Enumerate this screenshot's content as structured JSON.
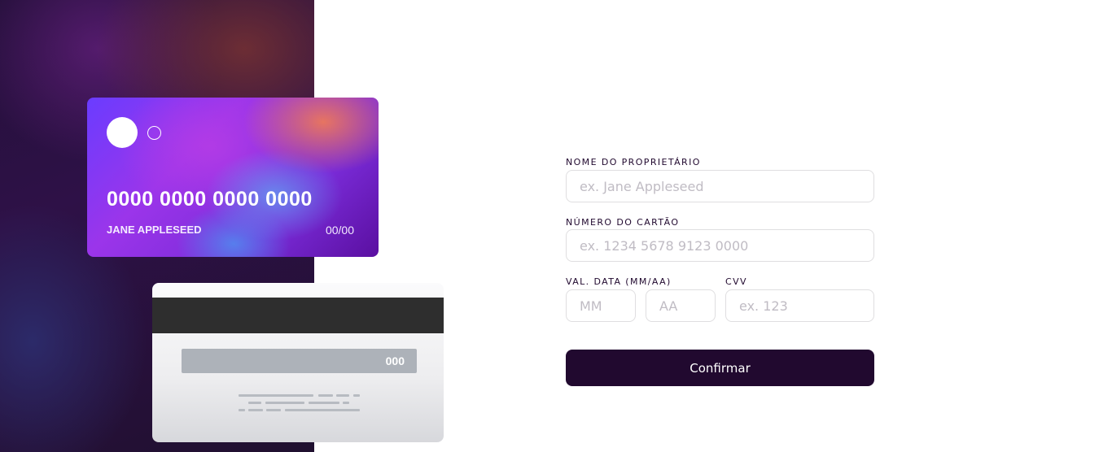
{
  "card_front": {
    "number": "0000 0000 0000 0000",
    "holder": "JANE APPLESEED",
    "expiry": "00/00"
  },
  "card_back": {
    "cvv": "000"
  },
  "form": {
    "name": {
      "label": "NOME DO PROPRIETÁRIO",
      "placeholder": "ex. Jane Appleseed",
      "value": ""
    },
    "number": {
      "label": "NÚMERO DO CARTÃO",
      "placeholder": "ex. 1234 5678 9123 0000",
      "value": ""
    },
    "expiry": {
      "label": "VAL. DATA (MM/AA)",
      "month_placeholder": "MM",
      "year_placeholder": "AA"
    },
    "cvv": {
      "label": "CVV",
      "placeholder": "ex. 123"
    },
    "confirm_label": "Confirmar"
  },
  "colors": {
    "dark_violet": "#21092f",
    "input_border": "#dfdee0",
    "placeholder": "#c0bcc4"
  }
}
